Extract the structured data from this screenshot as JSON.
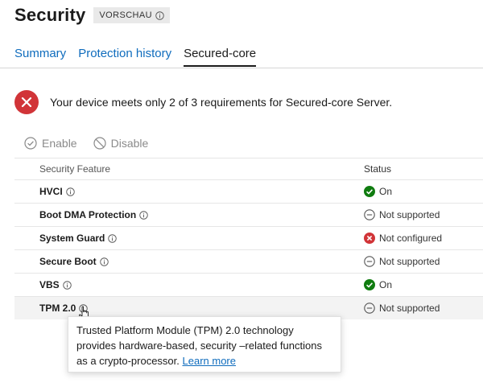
{
  "header": {
    "title": "Security",
    "badge": "VORSCHAU"
  },
  "tabs": [
    {
      "label": "Summary",
      "active": false
    },
    {
      "label": "Protection history",
      "active": false
    },
    {
      "label": "Secured-core",
      "active": true
    }
  ],
  "alert": {
    "text": "Your device meets only 2 of 3 requirements for Secured-core Server.",
    "color": "#d13438"
  },
  "toolbar": {
    "enable_label": "Enable",
    "disable_label": "Disable"
  },
  "table": {
    "headers": {
      "feature": "Security Feature",
      "status": "Status"
    },
    "rows": [
      {
        "feature": "HVCI",
        "status": "On",
        "status_icon": "check-circle-icon"
      },
      {
        "feature": "Boot DMA Protection",
        "status": "Not supported",
        "status_icon": "minus-circle-icon"
      },
      {
        "feature": "System Guard",
        "status": "Not configured",
        "status_icon": "error-circle-icon"
      },
      {
        "feature": "Secure Boot",
        "status": "Not supported",
        "status_icon": "minus-circle-icon"
      },
      {
        "feature": "VBS",
        "status": "On",
        "status_icon": "check-circle-icon"
      },
      {
        "feature": "TPM 2.0",
        "status": "Not supported",
        "status_icon": "minus-circle-icon"
      }
    ]
  },
  "tooltip": {
    "text": "Trusted Platform Module (TPM) 2.0 technology provides hardware-based, security –related functions as a crypto-processor.",
    "link": "Learn more"
  },
  "colors": {
    "accent": "#0f6cbd",
    "success": "#107c10",
    "error": "#d13438"
  }
}
